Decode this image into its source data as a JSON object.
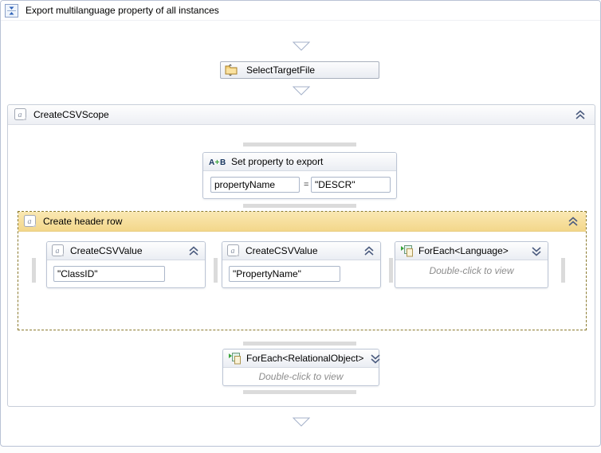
{
  "window": {
    "title": "Export multilanguage property of all instances"
  },
  "workflow": {
    "select_target_file": {
      "label": "SelectTargetFile"
    },
    "scope": {
      "label": "CreateCSVScope"
    },
    "assign": {
      "title": "Set property to export",
      "left_value": "propertyName",
      "operator": "=",
      "right_value": "\"DESCR\""
    },
    "header_row": {
      "label": "Create header row"
    },
    "csv_value_class": {
      "label": "CreateCSVValue",
      "value": "\"ClassID\""
    },
    "csv_value_property": {
      "label": "CreateCSVValue",
      "value": "\"PropertyName\""
    },
    "foreach_language": {
      "label": "ForEach<Language>",
      "hint": "Double-click to view"
    },
    "foreach_relational": {
      "label": "ForEach<RelationalObject>",
      "hint": "Double-click to view"
    }
  },
  "colors": {
    "selection_yellow": "#f6db93",
    "dashed_selection_border": "#8b7a2e",
    "grip_gray": "#dbdbdb",
    "window_border": "#b9c2d5",
    "chevron_blue": "#4d5d80"
  }
}
